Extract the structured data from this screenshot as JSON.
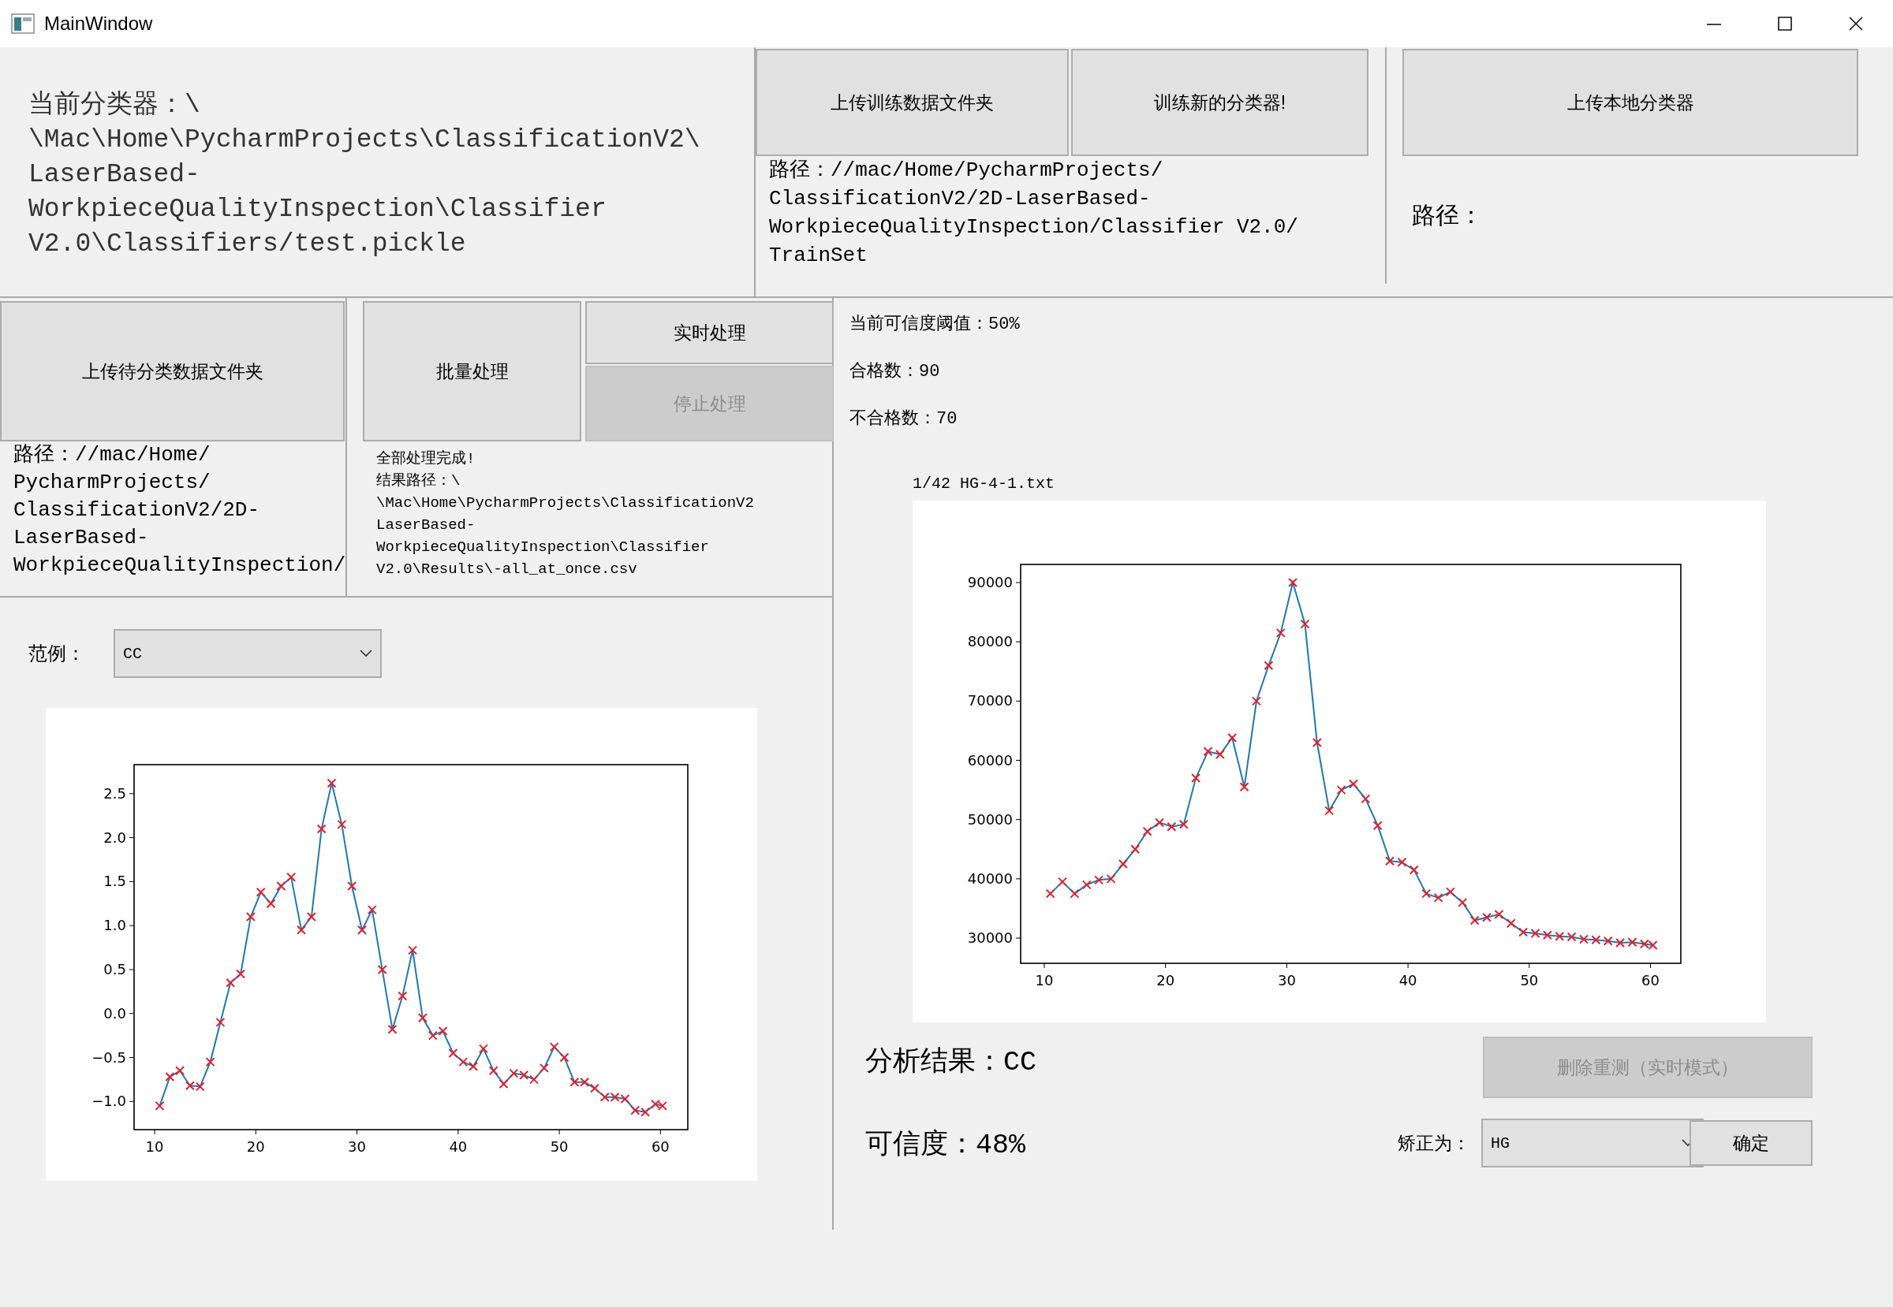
{
  "window": {
    "title": "MainWindow"
  },
  "classifier": {
    "current": "当前分类器：\\\n\\Mac\\Home\\PycharmProjects\\ClassificationV2\\\nLaserBased-\nWorkpieceQualityInspection\\Classifier\nV2.0\\Classifiers/test.pickle"
  },
  "training": {
    "buttons": [
      {
        "label": "上传训练数据文件夹",
        "disabled": false
      },
      {
        "label": "训练新的分类器!",
        "disabled": false
      }
    ],
    "path": "路径：//mac/Home/PycharmProjects/\nClassificationV2/2D-LaserBased-\nWorkpieceQualityInspection/Classifier V2.0/\nTrainSet"
  },
  "local_classifier": {
    "button": {
      "label": "上传本地分类器",
      "disabled": false
    },
    "path": "路径："
  },
  "classify": {
    "upload_button": {
      "label": "上传待分类数据文件夹",
      "disabled": false
    },
    "path": "路径：//mac/Home/\nPycharmProjects/\nClassificationV2/2D-\nLaserBased-\nWorkpieceQualityInspection/",
    "batch_button": {
      "label": "批量处理",
      "disabled": false
    },
    "realtime_button": {
      "label": "实时处理",
      "disabled": false
    },
    "stop_button": {
      "label": "停止处理",
      "disabled": true
    },
    "status": "全部处理完成!\n结果路径：\\\n\\Mac\\Home\\PycharmProjects\\ClassificationV2\nLaserBased-\nWorkpieceQualityInspection\\Classifier\nV2.0\\Results\\-all_at_once.csv"
  },
  "example": {
    "label": "范例：",
    "dropdown": {
      "value": "CC"
    },
    "chart_data": {
      "type": "line",
      "xlim": [
        7.97,
        62.7
      ],
      "ylim": [
        -1.32,
        2.83
      ],
      "xticks": [
        10,
        20,
        30,
        40,
        50,
        60
      ],
      "yticks": [
        {
          "value": -1,
          "label": "−1.0"
        },
        {
          "value": -0.5,
          "label": "−0.5"
        },
        {
          "value": 0,
          "label": "0.0"
        },
        {
          "value": 0.5,
          "label": "0.5"
        },
        {
          "value": 1,
          "label": "1.0"
        },
        {
          "value": 1.5,
          "label": "1.5"
        },
        {
          "value": 2,
          "label": "2.0"
        },
        {
          "value": 2.5,
          "label": "2.5"
        }
      ],
      "x": [
        10.5,
        11.5,
        12.5,
        13.5,
        14.5,
        15.5,
        16.5,
        17.5,
        18.5,
        19.5,
        20.5,
        21.5,
        22.5,
        23.5,
        24.5,
        25.5,
        26.5,
        27.5,
        28.5,
        29.5,
        30.5,
        31.5,
        32.5,
        33.5,
        34.5,
        35.5,
        36.5,
        37.5,
        38.5,
        39.5,
        40.5,
        41.5,
        42.5,
        43.5,
        44.5,
        45.5,
        46.5,
        47.5,
        48.5,
        49.5,
        50.5,
        51.5,
        52.5,
        53.5,
        54.5,
        55.5,
        56.5,
        57.5,
        58.5,
        59.5,
        60.2
      ],
      "series": [
        {
          "marker": "x",
          "color": "#1f77b4",
          "values": [
            -1.05,
            -0.72,
            -0.65,
            -0.82,
            -0.83,
            -0.55,
            -0.1,
            0.35,
            0.45,
            1.1,
            1.38,
            1.25,
            1.45,
            1.55,
            0.95,
            1.1,
            2.1,
            2.62,
            2.15,
            1.45,
            0.95,
            1.18,
            0.5,
            -0.18,
            0.2,
            0.72,
            -0.05,
            -0.25,
            -0.2,
            -0.45,
            -0.55,
            -0.6,
            -0.4,
            -0.65,
            -0.8,
            -0.68,
            -0.7,
            -0.75,
            -0.62,
            -0.38,
            -0.5,
            -0.78,
            -0.78,
            -0.85,
            -0.95,
            -0.95,
            -0.97,
            -1.1,
            -1.12,
            -1.03,
            -1.05
          ]
        }
      ]
    }
  },
  "stats": [
    "当前可信度阈值：50%",
    "合格数：90",
    "不合格数：70"
  ],
  "current_file": {
    "caption": "1/42 HG-4-1.txt",
    "chart_data": {
      "type": "line",
      "xlim": [
        8.05,
        62.5
      ],
      "ylim": [
        25743,
        93060
      ],
      "xticks": [
        10,
        20,
        30,
        40,
        50,
        60
      ],
      "yticks": [
        30000,
        40000,
        50000,
        60000,
        70000,
        80000,
        90000
      ],
      "x": [
        10.5,
        11.5,
        12.5,
        13.5,
        14.5,
        15.5,
        16.5,
        17.5,
        18.5,
        19.5,
        20.5,
        21.5,
        22.5,
        23.5,
        24.5,
        25.5,
        26.5,
        27.5,
        28.5,
        29.5,
        30.5,
        31.5,
        32.5,
        33.5,
        34.5,
        35.5,
        36.5,
        37.5,
        38.5,
        39.5,
        40.5,
        41.5,
        42.5,
        43.5,
        44.5,
        45.5,
        46.5,
        47.5,
        48.5,
        49.5,
        50.5,
        51.5,
        52.5,
        53.5,
        54.5,
        55.5,
        56.5,
        57.5,
        58.5,
        59.5,
        60.2
      ],
      "series": [
        {
          "marker": "x",
          "color": "#1f77b4",
          "values": [
            37500,
            39500,
            37500,
            39000,
            39800,
            40000,
            42500,
            45000,
            48000,
            49500,
            48800,
            49200,
            57000,
            61500,
            61000,
            63800,
            55500,
            70000,
            76000,
            81500,
            90000,
            83000,
            63000,
            51500,
            55000,
            56000,
            53500,
            49000,
            43000,
            42800,
            41500,
            37500,
            36800,
            37800,
            36000,
            33000,
            33500,
            34000,
            32500,
            31000,
            30800,
            30500,
            30300,
            30200,
            29800,
            29700,
            29500,
            29200,
            29300,
            29000,
            28800
          ]
        }
      ]
    }
  },
  "result": {
    "text": "分析结果：CC",
    "remeasure_button": {
      "label": "删除重测（实时模式）",
      "disabled": true
    },
    "confidence": "可信度：48%",
    "correct_label": "矫正为：",
    "correct_dropdown": {
      "value": "HG"
    },
    "confirm_button": {
      "label": "确定",
      "disabled": false
    }
  }
}
